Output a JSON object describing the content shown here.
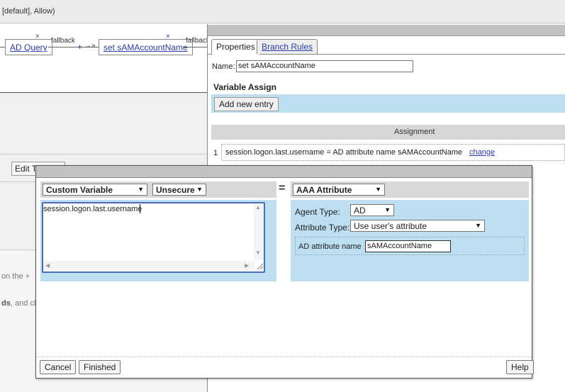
{
  "background": {
    "top_label": "[default], Allow)",
    "flow": {
      "node1": "AD Query",
      "branch1": "fallback",
      "node2": "set sAMAccountName",
      "branch2": "fallback",
      "remove_icon": "×",
      "plus": "+",
      "arrow": "→»"
    },
    "edit_terminals_label": "Edit T",
    "info_line1": "on the +",
    "info_line2_bold": "ds",
    "info_line2": ", and clic"
  },
  "properties": {
    "tabs": [
      {
        "label": "Properties",
        "active": true
      },
      {
        "label": "Branch Rules",
        "active": false
      }
    ],
    "name_label": "Name:",
    "name_value": "set sAMAccountName",
    "section_title": "Variable Assign",
    "add_entry_label": "Add new entry",
    "table": {
      "column_header": "Assignment",
      "rows": [
        {
          "num": "1",
          "text": "session.logon.last.username = AD attribute name sAMAccountName",
          "action": "change"
        }
      ]
    }
  },
  "dialog": {
    "left": {
      "type_select": "Custom Variable",
      "security_select": "Unsecure",
      "expression": "session.logon.last.username"
    },
    "equals": "=",
    "right": {
      "type_select": "AAA Attribute",
      "agent_type_label": "Agent Type:",
      "agent_type_value": "AD",
      "attribute_type_label": "Attribute Type:",
      "attribute_type_value": "Use user's attribute",
      "ad_attribute_label": "AD attribute name",
      "ad_attribute_value": "sAMAccountName"
    },
    "buttons": {
      "cancel": "Cancel",
      "finished": "Finished",
      "help": "Help"
    }
  },
  "icons": {
    "dropdown": "▼",
    "scroll_up": "▲",
    "scroll_down": "▼",
    "scroll_left": "◀",
    "scroll_right": "▶"
  },
  "colors": {
    "link": "#2a3ca8",
    "panel_blue": "#bedef2",
    "title_gray": "#c2c2c2"
  }
}
